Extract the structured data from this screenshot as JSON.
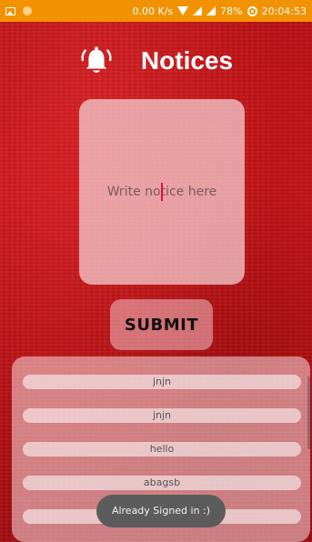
{
  "status_bar": {
    "speed": "0.00 K/s",
    "battery": "78%",
    "time": "20:04:53"
  },
  "header": {
    "title": "Notices",
    "icon": "bell-icon"
  },
  "notice_input": {
    "placeholder": "Write notice here"
  },
  "submit_label": "SUBMIT",
  "notices": [
    "jnjn",
    "jnjn",
    "hello",
    "abagsb",
    ""
  ],
  "toast": "Already Signed in :)"
}
